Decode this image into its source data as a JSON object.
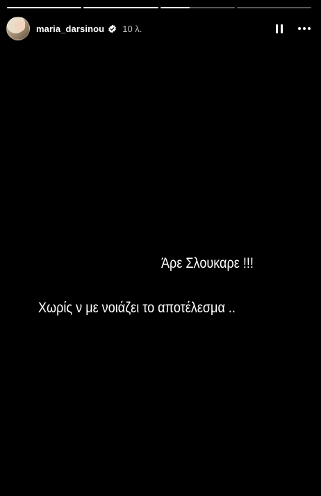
{
  "story": {
    "progress": [
      1,
      1,
      0.4,
      0
    ],
    "author": {
      "username": "maria_darsinou",
      "verified": true,
      "time": "10 λ."
    },
    "controls": {
      "pause_icon": "pause-icon",
      "more_icon": "more-icon"
    },
    "text": {
      "line1": "Άρε Σλουκαρε !!!",
      "line2": "Χωρίς ν με νοιάζει το αποτέλεσμα .."
    }
  }
}
